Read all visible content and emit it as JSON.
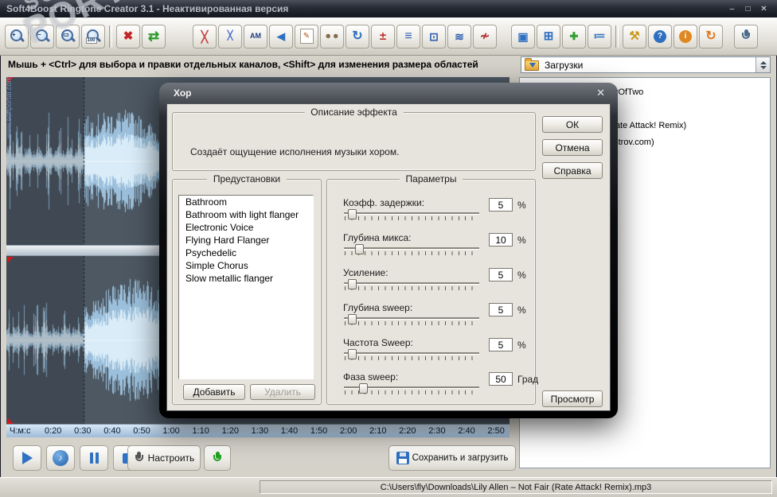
{
  "window": {
    "title": "Soft4Boost Ringtone Creator 3.1 - Неактивированная версия",
    "controls": {
      "minimize": "–",
      "maximize": "□",
      "close": "✕"
    }
  },
  "toolbar": {
    "hint": "Мышь + <Ctrl> для выбора и правки отдельных каналов, <Shift> для изменения размера областей",
    "downloads_combo": "Загрузки",
    "icons": [
      {
        "name": "zoom-in-icon",
        "type": "mag",
        "sub": "+"
      },
      {
        "name": "zoom-out-icon",
        "type": "mag",
        "sub": "−"
      },
      {
        "name": "zoom-selection-icon",
        "type": "mag",
        "sub": "▭"
      },
      {
        "name": "zoom-100-icon",
        "type": "mag",
        "sub": "100"
      },
      {
        "type": "sep"
      },
      {
        "name": "delete-icon",
        "type": "glyph",
        "glyph": "✖",
        "color": "#c22525",
        "size": 15
      },
      {
        "name": "undo-redo-icon",
        "type": "glyph",
        "glyph": "⇄",
        "color": "#2c9a2c",
        "size": 17
      },
      {
        "type": "gap",
        "w": 30
      },
      {
        "name": "fade-cross-icon",
        "type": "glyph",
        "glyph": "╳",
        "color": "#c04545",
        "size": 14
      },
      {
        "name": "fade-lines-icon",
        "type": "glyph",
        "glyph": "╳",
        "color": "#4868c8",
        "size": 11
      },
      {
        "name": "amplitude-icon",
        "type": "glyph",
        "glyph": "AM",
        "color": "#1f3a7e",
        "size": 9
      },
      {
        "name": "reverse-icon",
        "type": "glyph",
        "glyph": "◀",
        "color": "#2f6fc0",
        "size": 13
      },
      {
        "name": "edit-notes-icon",
        "type": "page"
      },
      {
        "name": "chorus-icon",
        "type": "glyph",
        "glyph": "☻☻",
        "color": "#7a5a3a",
        "size": 9
      },
      {
        "name": "tempo-icon",
        "type": "glyph",
        "glyph": "↻",
        "color": "#2f6fc0",
        "size": 16
      },
      {
        "name": "pitch-icon",
        "type": "glyph",
        "glyph": "±",
        "color": "#c03030",
        "size": 15
      },
      {
        "name": "echo-icon",
        "type": "glyph",
        "glyph": "≡",
        "color": "#3060b0",
        "size": 16
      },
      {
        "name": "envelope-icon",
        "type": "glyph",
        "glyph": "⊡",
        "color": "#3060b0",
        "size": 14
      },
      {
        "name": "flanger-icon",
        "type": "glyph",
        "glyph": "≋",
        "color": "#3060b0",
        "size": 14
      },
      {
        "name": "noise-reduction-icon",
        "type": "glyph",
        "glyph": "≁",
        "color": "#b03030",
        "size": 15
      },
      {
        "type": "gap",
        "w": 14
      },
      {
        "name": "copy-channels-icon",
        "type": "glyph",
        "glyph": "▣",
        "color": "#2f6fc0",
        "size": 14
      },
      {
        "name": "import-file-icon",
        "type": "glyph",
        "glyph": "⊞",
        "color": "#2f6fc0",
        "size": 15
      },
      {
        "name": "add-file-icon",
        "type": "glyph",
        "glyph": "✚",
        "color": "#2e9e2e",
        "size": 13
      },
      {
        "name": "playlist-icon",
        "type": "glyph",
        "glyph": "≔",
        "color": "#2f6fc0",
        "size": 15
      },
      {
        "type": "sep"
      },
      {
        "name": "settings-icon",
        "type": "glyph",
        "glyph": "⚒",
        "color": "#c89a20",
        "size": 15
      },
      {
        "name": "help-icon",
        "type": "circle",
        "glyph": "?",
        "color": "#2f6fc0"
      },
      {
        "name": "about-icon",
        "type": "circle",
        "glyph": "i",
        "color": "#e08820"
      },
      {
        "name": "update-icon",
        "type": "glyph",
        "glyph": "↻",
        "color": "#e07820",
        "size": 16
      },
      {
        "type": "gap",
        "w": 10
      },
      {
        "name": "record-mic-icon",
        "type": "mic",
        "color": "#4a6a8a"
      }
    ]
  },
  "watermark": {
    "top": "SOFT",
    "big": "PORTAL™",
    "side": "www.softportal.com"
  },
  "timeline": {
    "unit": "Ч:м:с",
    "ticks": [
      "0:20",
      "0:30",
      "0:40",
      "0:50",
      "1:00",
      "1:10",
      "1:20",
      "1:30",
      "1:40",
      "1:50",
      "2:00",
      "2:10",
      "2:20",
      "2:30",
      "2:40",
      "2:50"
    ]
  },
  "transport": {
    "configure_label": "Настроить",
    "save_label": "Сохранить и загрузить",
    "note_glyph": "♪"
  },
  "right_panel": {
    "lines": [
      "yOfTwo",
      "Rate Attack! Remix)",
      "ostrov.com)"
    ]
  },
  "statusbar": {
    "path": "C:\\Users\\fly\\Downloads\\Lily Allen – Not Fair (Rate Attack! Remix).mp3"
  },
  "dialog": {
    "title": "Хор",
    "close": "✕",
    "description_group": "Описание эффекта",
    "description": "Создаёт ощущение исполнения музыки хором.",
    "presets_group": "Предустановки",
    "presets": [
      "Bathroom",
      "Bathroom with light flanger",
      "Electronic Voice",
      "Flying Hard Flanger",
      "Psychedelic",
      "Simple Chorus",
      "Slow metallic flanger"
    ],
    "params_group": "Параметры",
    "params": [
      {
        "label": "Коэфф. задержки:",
        "value": "5",
        "unit": "%",
        "pos": 6
      },
      {
        "label": "Глубина микса:",
        "value": "10",
        "unit": "%",
        "pos": 11
      },
      {
        "label": "Усиление:",
        "value": "5",
        "unit": "%",
        "pos": 6
      },
      {
        "label": "Глубина sweep:",
        "value": "5",
        "unit": "%",
        "pos": 6
      },
      {
        "label": "Частота Sweep:",
        "value": "5",
        "unit": "%",
        "pos": 6
      },
      {
        "label": "Фаза sweep:",
        "value": "50",
        "unit": "Град",
        "pos": 14
      }
    ],
    "buttons": {
      "ok": "ОК",
      "cancel": "Отмена",
      "help": "Справка",
      "add": "Добавить",
      "remove": "Удалить",
      "preview": "Просмотр"
    }
  }
}
